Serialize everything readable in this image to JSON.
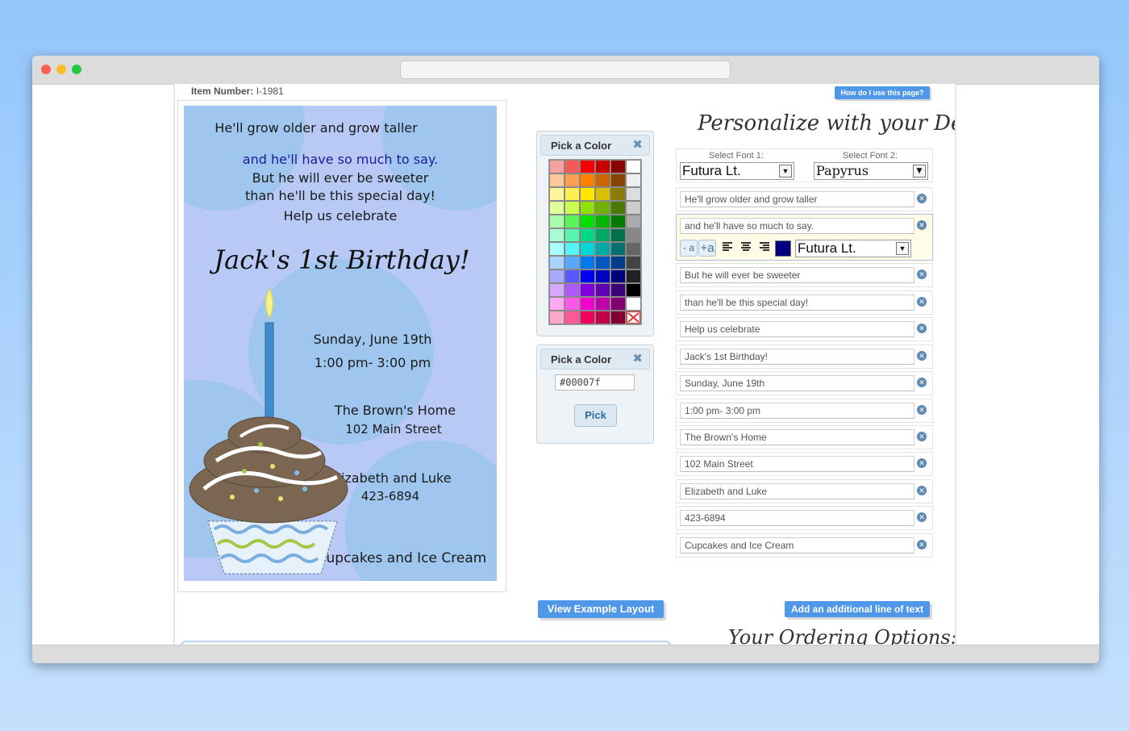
{
  "item": {
    "label": "Item Number:",
    "value": "I-1981"
  },
  "help_button": "How do I use this page?",
  "card": {
    "lines": [
      "He'll grow older and grow taller",
      "and he'll have so much to say.",
      "But he will ever be sweeter",
      "than he'll be this special day!",
      "Help us celebrate",
      "Jack's 1st Birthday!",
      "Sunday, June 19th",
      "1:00 pm- 3:00 pm",
      "The Brown's Home",
      "102 Main Street",
      "Elizabeth and Luke",
      "423-6894",
      "Cupcakes and Ice Cream"
    ],
    "colors": {
      "background": "#b8c9f6",
      "circles": "#9ec6ee",
      "highlight_line": "#1a1a9c"
    }
  },
  "picker1": {
    "title": "Pick a Color",
    "close": "✖"
  },
  "picker2": {
    "title": "Pick a Color",
    "close": "✖",
    "value": "#00007f",
    "pick_label": "Pick"
  },
  "swatch_colors": [
    "#f7a0a0",
    "#f75858",
    "#f40000",
    "#c80000",
    "#8b0000",
    "#ffffff",
    "#fcc89a",
    "#fca050",
    "#ff8000",
    "#cc6600",
    "#884400",
    "#eeeeee",
    "#fff59a",
    "#fff050",
    "#ffe600",
    "#d8c000",
    "#8a7c00",
    "#dddddd",
    "#e0ff9a",
    "#c8ff50",
    "#90e000",
    "#70b000",
    "#4a7a00",
    "#cccccc",
    "#a8ffa8",
    "#58f458",
    "#00e000",
    "#00b400",
    "#007a00",
    "#aaaaaa",
    "#a8ffd6",
    "#58f4b0",
    "#00d884",
    "#00a864",
    "#00704a",
    "#888888",
    "#a8ffff",
    "#58f4f4",
    "#00d8d8",
    "#00a8a8",
    "#007070",
    "#666666",
    "#a8d4ff",
    "#58a8ff",
    "#0078f0",
    "#0058c0",
    "#003c88",
    "#444444",
    "#a8a8ff",
    "#5858ff",
    "#0000f0",
    "#0000c0",
    "#00007f",
    "#222222",
    "#d6a8ff",
    "#b058ff",
    "#8000e0",
    "#6000b0",
    "#3e0078",
    "#000000",
    "#ffa8f4",
    "#ff58e8",
    "#f000d0",
    "#c000a8",
    "#800070",
    "#ffffff",
    "#ffa8cc",
    "#ff5898",
    "#f00060",
    "#c00048",
    "#800030",
    "none"
  ],
  "personalize": {
    "title": "Personalize with your Details"
  },
  "font1": {
    "label": "Select Font 1:",
    "value": "Futura Lt."
  },
  "font2": {
    "label": "Select Font 2:",
    "value": "Papyrus"
  },
  "text_lines": [
    "He'll grow older and grow taller",
    "and he'll have so much to say.",
    "But he will ever be sweeter",
    "than he'll be this special day!",
    "Help us celebrate",
    "Jack's 1st Birthday!",
    "Sunday, June 19th",
    "1:00 pm- 3:00 pm",
    "The Brown's Home",
    "102 Main Street",
    "Elizabeth and Luke",
    "423-6894",
    "Cupcakes and Ice Cream"
  ],
  "active_line": {
    "shrink": "- a",
    "grow": "+a",
    "color": "#00007f",
    "font": "Futura Lt."
  },
  "view_example_button": "View Example Layout",
  "add_line_button": "Add an additional line of text",
  "ordering": {
    "title": "Your Ordering Options:"
  }
}
